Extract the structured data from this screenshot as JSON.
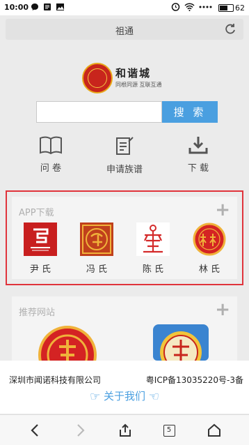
{
  "status_bar": {
    "time": "10:00",
    "battery": "62",
    "battery_level": 0.62,
    "left_icons": [
      "messenger-icon",
      "notification-icon",
      "image-icon"
    ],
    "right_icons": [
      "alarm-icon",
      "wifi-icon",
      "signal-icon"
    ]
  },
  "browser": {
    "page_title": "祖通"
  },
  "search": {
    "placeholder": "",
    "value": "",
    "button_label": "搜 索"
  },
  "quick_links": [
    {
      "label": "问 卷",
      "icon": "book-icon"
    },
    {
      "label": "申请族谱",
      "icon": "edit-document-icon"
    },
    {
      "label": "下 载",
      "icon": "download-icon"
    }
  ],
  "app_section": {
    "title": "APP下载",
    "apps": [
      {
        "label": "尹 氏",
        "icon": "yin-clan-app-icon"
      },
      {
        "label": "冯 氏",
        "icon": "feng-clan-app-icon"
      },
      {
        "label": "陈 氏",
        "icon": "chen-clan-app-icon"
      },
      {
        "label": "林 氏",
        "icon": "lin-clan-app-icon"
      }
    ]
  },
  "sites_section": {
    "title": "推荐网站"
  },
  "footer": {
    "company": "深圳市闻诺科技有限公司",
    "icp": "粤ICP备13035220号-3备",
    "about": "关于我们"
  },
  "bottom_nav": {
    "tab_count": "5"
  },
  "colors": {
    "accent_blue": "#4a9fe0",
    "highlight_red": "#e0333b",
    "seal_red": "#c8251c"
  }
}
